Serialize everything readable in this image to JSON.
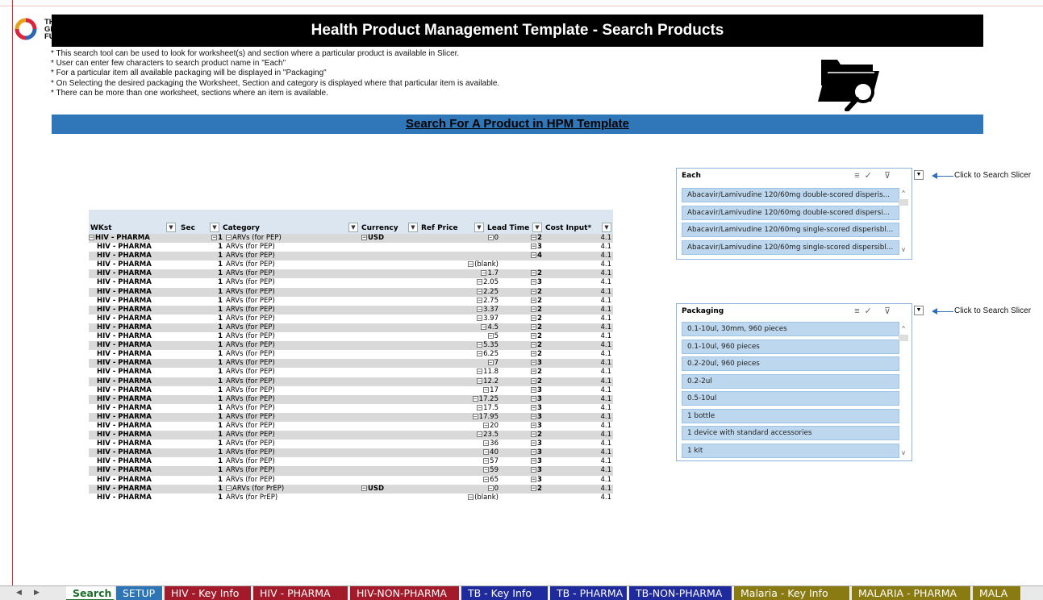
{
  "banner": {
    "title": "Health Product Management Template - Search Products"
  },
  "logo": {
    "line1": "THE",
    "line2": "GLOBAL",
    "line3": "FUND"
  },
  "notes": [
    "* This search tool can be used to look for worksheet(s) and section where a particular product is available in Slicer.",
    "* User can enter few characters to search product name in \"Each\"",
    "* For a  particular item all available packaging will be displayed in \"Packaging\"",
    "* On Selecting the desired packaging the Worksheet, Section and category is displayed where that particular item is available.",
    "* There can be more than one worksheet, sections where an item is available."
  ],
  "search_title": "Search For A Product in HPM Template",
  "pivot": {
    "headers": {
      "wkst": "WKst",
      "sec": "Sec",
      "category": "Category",
      "currency": "Currency",
      "ref_price": "Ref Price",
      "lead_time": "Lead Time",
      "cost_input": "Cost Input*"
    },
    "rows": [
      {
        "wk": "HIV - PHARMA",
        "sec": "1",
        "cat": "ARVs (for PEP)",
        "cur": "USD",
        "ref": "0",
        "lead": "2",
        "cost": "4.1",
        "alt": true,
        "first": true
      },
      {
        "wk": "HIV - PHARMA",
        "sec": "1",
        "cat": "ARVs (for PEP)",
        "cur": "",
        "ref": "",
        "lead": "3",
        "cost": "4.1",
        "alt": false
      },
      {
        "wk": "HIV - PHARMA",
        "sec": "1",
        "cat": "ARVs (for PEP)",
        "cur": "",
        "ref": "",
        "lead": "4",
        "cost": "4.1",
        "alt": true
      },
      {
        "wk": "HIV - PHARMA",
        "sec": "1",
        "cat": "ARVs (for PEP)",
        "cur": "",
        "ref": "(blank)",
        "lead": "",
        "cost": "4.1",
        "alt": false
      },
      {
        "wk": "HIV - PHARMA",
        "sec": "1",
        "cat": "ARVs (for PEP)",
        "cur": "",
        "ref": "1.7",
        "lead": "2",
        "cost": "4.1",
        "alt": true
      },
      {
        "wk": "HIV - PHARMA",
        "sec": "1",
        "cat": "ARVs (for PEP)",
        "cur": "",
        "ref": "2.05",
        "lead": "3",
        "cost": "4.1",
        "alt": false
      },
      {
        "wk": "HIV - PHARMA",
        "sec": "1",
        "cat": "ARVs (for PEP)",
        "cur": "",
        "ref": "2.25",
        "lead": "2",
        "cost": "4.1",
        "alt": true
      },
      {
        "wk": "HIV - PHARMA",
        "sec": "1",
        "cat": "ARVs (for PEP)",
        "cur": "",
        "ref": "2.75",
        "lead": "2",
        "cost": "4.1",
        "alt": false
      },
      {
        "wk": "HIV - PHARMA",
        "sec": "1",
        "cat": "ARVs (for PEP)",
        "cur": "",
        "ref": "3.37",
        "lead": "2",
        "cost": "4.1",
        "alt": true
      },
      {
        "wk": "HIV - PHARMA",
        "sec": "1",
        "cat": "ARVs (for PEP)",
        "cur": "",
        "ref": "3.97",
        "lead": "2",
        "cost": "4.1",
        "alt": false
      },
      {
        "wk": "HIV - PHARMA",
        "sec": "1",
        "cat": "ARVs (for PEP)",
        "cur": "",
        "ref": "4.5",
        "lead": "2",
        "cost": "4.1",
        "alt": true
      },
      {
        "wk": "HIV - PHARMA",
        "sec": "1",
        "cat": "ARVs (for PEP)",
        "cur": "",
        "ref": "5",
        "lead": "2",
        "cost": "4.1",
        "alt": false
      },
      {
        "wk": "HIV - PHARMA",
        "sec": "1",
        "cat": "ARVs (for PEP)",
        "cur": "",
        "ref": "5.35",
        "lead": "2",
        "cost": "4.1",
        "alt": true
      },
      {
        "wk": "HIV - PHARMA",
        "sec": "1",
        "cat": "ARVs (for PEP)",
        "cur": "",
        "ref": "6.25",
        "lead": "2",
        "cost": "4.1",
        "alt": false
      },
      {
        "wk": "HIV - PHARMA",
        "sec": "1",
        "cat": "ARVs (for PEP)",
        "cur": "",
        "ref": "7",
        "lead": "3",
        "cost": "4.1",
        "alt": true
      },
      {
        "wk": "HIV - PHARMA",
        "sec": "1",
        "cat": "ARVs (for PEP)",
        "cur": "",
        "ref": "11.8",
        "lead": "2",
        "cost": "4.1",
        "alt": false
      },
      {
        "wk": "HIV - PHARMA",
        "sec": "1",
        "cat": "ARVs (for PEP)",
        "cur": "",
        "ref": "12.2",
        "lead": "2",
        "cost": "4.1",
        "alt": true
      },
      {
        "wk": "HIV - PHARMA",
        "sec": "1",
        "cat": "ARVs (for PEP)",
        "cur": "",
        "ref": "17",
        "lead": "3",
        "cost": "4.1",
        "alt": false
      },
      {
        "wk": "HIV - PHARMA",
        "sec": "1",
        "cat": "ARVs (for PEP)",
        "cur": "",
        "ref": "17.25",
        "lead": "3",
        "cost": "4.1",
        "alt": true
      },
      {
        "wk": "HIV - PHARMA",
        "sec": "1",
        "cat": "ARVs (for PEP)",
        "cur": "",
        "ref": "17.5",
        "lead": "3",
        "cost": "4.1",
        "alt": false
      },
      {
        "wk": "HIV - PHARMA",
        "sec": "1",
        "cat": "ARVs (for PEP)",
        "cur": "",
        "ref": "17.95",
        "lead": "3",
        "cost": "4.1",
        "alt": true
      },
      {
        "wk": "HIV - PHARMA",
        "sec": "1",
        "cat": "ARVs (for PEP)",
        "cur": "",
        "ref": "20",
        "lead": "3",
        "cost": "4.1",
        "alt": false
      },
      {
        "wk": "HIV - PHARMA",
        "sec": "1",
        "cat": "ARVs (for PEP)",
        "cur": "",
        "ref": "23.5",
        "lead": "2",
        "cost": "4.1",
        "alt": true
      },
      {
        "wk": "HIV - PHARMA",
        "sec": "1",
        "cat": "ARVs (for PEP)",
        "cur": "",
        "ref": "36",
        "lead": "3",
        "cost": "4.1",
        "alt": false
      },
      {
        "wk": "HIV - PHARMA",
        "sec": "1",
        "cat": "ARVs (for PEP)",
        "cur": "",
        "ref": "40",
        "lead": "3",
        "cost": "4.1",
        "alt": true
      },
      {
        "wk": "HIV - PHARMA",
        "sec": "1",
        "cat": "ARVs (for PEP)",
        "cur": "",
        "ref": "57",
        "lead": "3",
        "cost": "4.1",
        "alt": false
      },
      {
        "wk": "HIV - PHARMA",
        "sec": "1",
        "cat": "ARVs (for PEP)",
        "cur": "",
        "ref": "59",
        "lead": "3",
        "cost": "4.1",
        "alt": true
      },
      {
        "wk": "HIV - PHARMA",
        "sec": "1",
        "cat": "ARVs (for PEP)",
        "cur": "",
        "ref": "65",
        "lead": "3",
        "cost": "4.1",
        "alt": false
      },
      {
        "wk": "HIV - PHARMA",
        "sec": "1",
        "cat": "ARVs (for PrEP)",
        "cur": "USD",
        "ref": "0",
        "lead": "2",
        "cost": "4.1",
        "alt": true
      },
      {
        "wk": "HIV - PHARMA",
        "sec": "1",
        "cat": "ARVs (for PrEP)",
        "cur": "",
        "ref": "(blank)",
        "lead": "",
        "cost": "4.1",
        "alt": false
      }
    ]
  },
  "slicer_each": {
    "title": "Each",
    "items": [
      "Abacavir/Lamivudine 120/60mg double-scored disperis...",
      "Abacavir/Lamivudine 120/60mg double-scored dispersi...",
      "Abacavir/Lamivudine 120/60mg single-scored disperisbl...",
      "Abacavir/Lamivudine 120/60mg single-scored dispersibl..."
    ],
    "callout": "Click to Search Slicer"
  },
  "slicer_packaging": {
    "title": "Packaging",
    "items": [
      "0.1-10ul, 30mm, 960 pieces",
      "0.1-10ul, 960 pieces",
      "0.2-20ul, 960 pieces",
      "0.2-2ul",
      "0.5-10ul",
      "1 bottle",
      "1 device with standard accessories",
      "1 kit"
    ],
    "callout": "Click to Search Slicer"
  },
  "tabs": [
    {
      "label": "Search",
      "color": "#ffffff",
      "active": true
    },
    {
      "label": "SETUP",
      "color": "#2e75b6"
    },
    {
      "label": "HIV - Key Info",
      "color": "#a31b2a"
    },
    {
      "label": "HIV - PHARMA",
      "color": "#a31b2a"
    },
    {
      "label": "HIV-NON-PHARMA",
      "color": "#a31b2a"
    },
    {
      "label": "TB - Key Info",
      "color": "#1f2a9c"
    },
    {
      "label": "TB - PHARMA",
      "color": "#1f2a9c"
    },
    {
      "label": "TB-NON-PHARMA",
      "color": "#1f2a9c"
    },
    {
      "label": "Malaria - Key Info",
      "color": "#8a7a12"
    },
    {
      "label": "MALARIA - PHARMA",
      "color": "#8a7a12"
    },
    {
      "label": "MALA",
      "color": "#8a7a12"
    }
  ],
  "colors": {
    "banner": "#000000",
    "title_bar": "#2f77b8",
    "slicer_item": "#bdd7ee"
  }
}
